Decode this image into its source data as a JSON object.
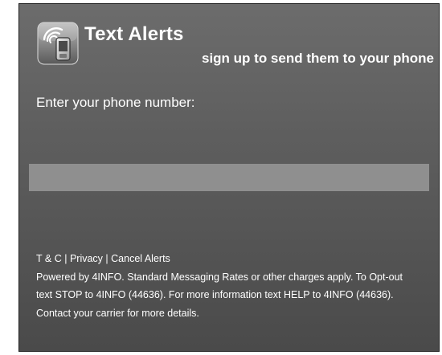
{
  "header": {
    "title": "Text Alerts",
    "subtitle": "sign up to send them to your phone",
    "logo_icon": "phone-signal-icon"
  },
  "form": {
    "prompt": "Enter your phone number:",
    "phone_value": ""
  },
  "footer": {
    "links": {
      "terms": "T & C",
      "privacy": "Privacy",
      "cancel": "Cancel Alerts",
      "separator": "|"
    },
    "lines": [
      "Powered by 4INFO. Standard Messaging Rates or other charges apply. To Opt-out",
      "text STOP to 4INFO (44636). For more information text HELP to 4INFO (44636).",
      "Contact your carrier for more details."
    ]
  },
  "colors": {
    "background_top": "#6c6c6c",
    "background_bottom": "#4a4a4a",
    "input_fill": "#8f8f8f",
    "text": "#ffffff"
  }
}
